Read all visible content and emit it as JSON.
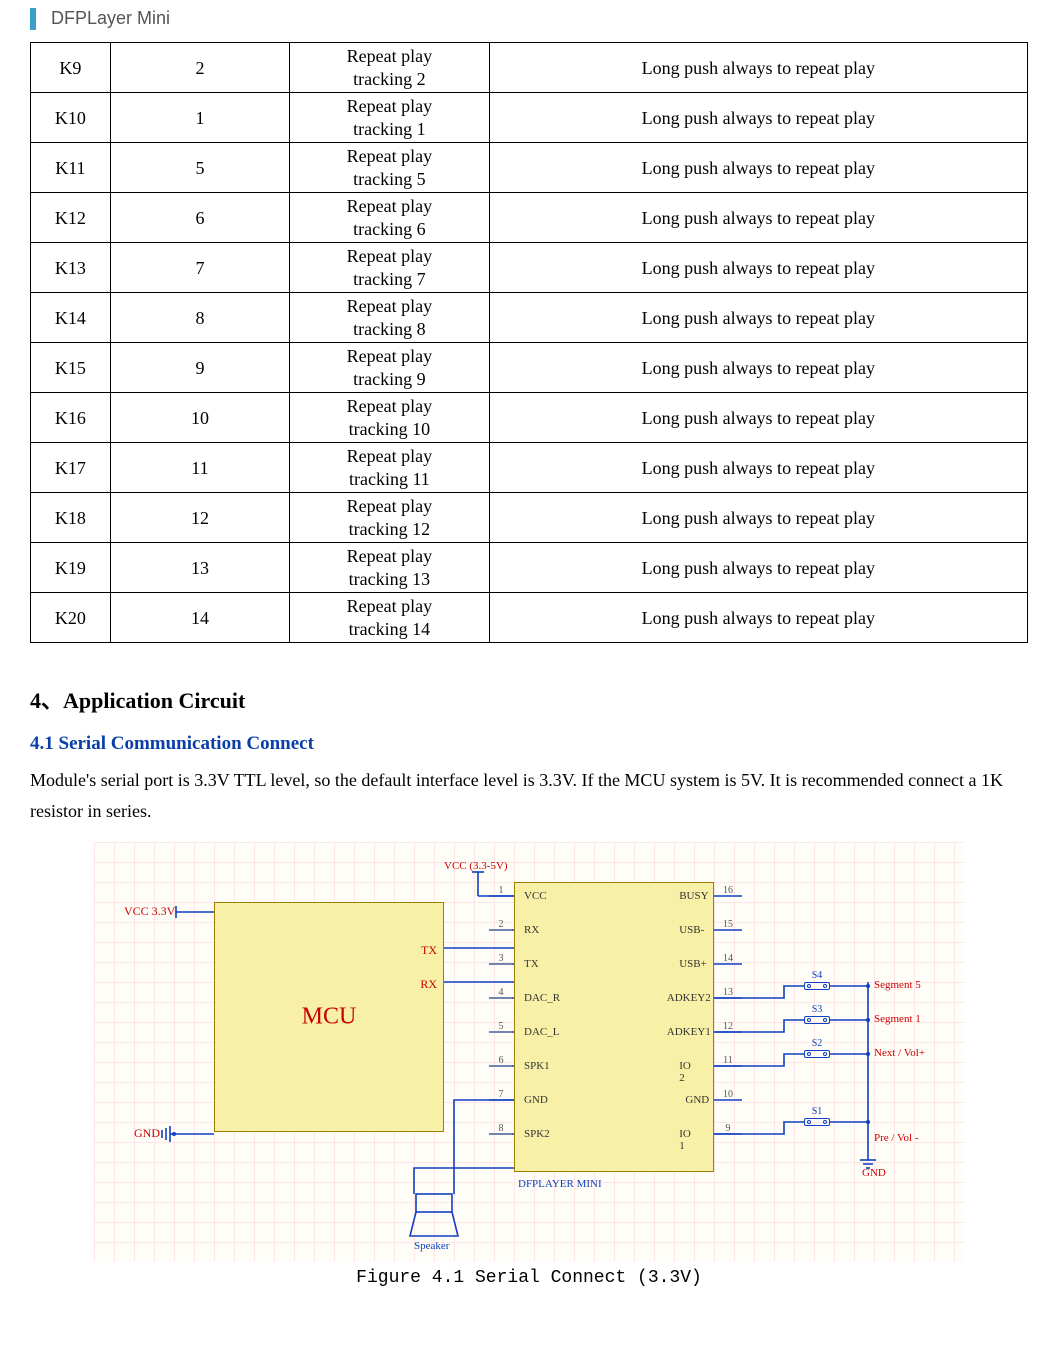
{
  "header": {
    "title": "DFPLayer Mini"
  },
  "table": {
    "rows": [
      {
        "key": "K9",
        "val": "2",
        "long": "Repeat play tracking 2",
        "note": "Long push always to repeat play"
      },
      {
        "key": "K10",
        "val": "1",
        "long": "Repeat play tracking 1",
        "note": "Long push always to repeat play"
      },
      {
        "key": "K11",
        "val": "5",
        "long": "Repeat play tracking 5",
        "note": "Long push always to repeat play"
      },
      {
        "key": "K12",
        "val": "6",
        "long": "Repeat play tracking 6",
        "note": "Long push always to repeat play"
      },
      {
        "key": "K13",
        "val": "7",
        "long": "Repeat play tracking 7",
        "note": "Long push always to repeat play"
      },
      {
        "key": "K14",
        "val": "8",
        "long": "Repeat play tracking 8",
        "note": "Long push always to repeat play"
      },
      {
        "key": "K15",
        "val": "9",
        "long": "Repeat play tracking 9",
        "note": "Long push always to repeat play"
      },
      {
        "key": "K16",
        "val": "10",
        "long": "Repeat play tracking 10",
        "note": "Long push always to repeat play"
      },
      {
        "key": "K17",
        "val": "11",
        "long": "Repeat play tracking 11",
        "note": "Long push always to repeat play"
      },
      {
        "key": "K18",
        "val": "12",
        "long": "Repeat play tracking 12",
        "note": "Long push always to repeat play"
      },
      {
        "key": "K19",
        "val": "13",
        "long": "Repeat play tracking 13",
        "note": "Long push always to repeat play"
      },
      {
        "key": "K20",
        "val": "14",
        "long": "Repeat play tracking 14",
        "note": "Long push always to repeat play"
      }
    ]
  },
  "section": {
    "title": "4、Application Circuit"
  },
  "subsection": {
    "title": "4.1 Serial Communication Connect"
  },
  "paragraph": "Module's serial port is 3.3V TTL level, so the default interface level is 3.3V. If the MCU system is 5V. It is recommended connect a 1K resistor in series.",
  "diagram": {
    "mcu": {
      "label": "MCU",
      "tx": "TX",
      "rx": "RX",
      "vcc": "VCC 3.3V",
      "gnd": "GND"
    },
    "module_label": "DFPLAYER MINI",
    "dfp_vcc_lbl": "VCC (3.3-5V)",
    "left_pins": [
      "VCC",
      "RX",
      "TX",
      "DAC_R",
      "DAC_L",
      "SPK1",
      "GND",
      "SPK2"
    ],
    "right_pins": [
      "BUSY",
      "USB-",
      "USB+",
      "ADKEY2",
      "ADKEY1",
      "IO 2",
      "GND",
      "IO 1"
    ],
    "left_nums": [
      "1",
      "2",
      "3",
      "4",
      "5",
      "6",
      "7",
      "8"
    ],
    "right_nums": [
      "16",
      "15",
      "14",
      "13",
      "12",
      "11",
      "10",
      "9"
    ],
    "buttons": {
      "s1": "S1",
      "s2": "S2",
      "s3": "S3",
      "s4": "S4"
    },
    "sig": {
      "seg5": "Segment 5",
      "seg1": "Segment 1",
      "nv": "Next / Vol+",
      "pv": "Pre / Vol -",
      "gnd": "GND"
    },
    "speaker": "Speaker"
  },
  "figure_caption": "Figure 4.1 Serial Connect (3.3V)"
}
